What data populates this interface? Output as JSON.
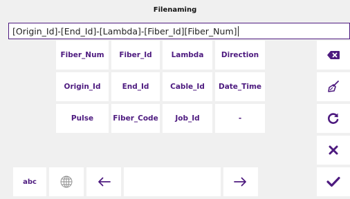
{
  "window": {
    "title": "Filenaming"
  },
  "input": {
    "value": "[Origin_Id]-[End_Id]-[Lambda]-[Fiber_Id][Fiber_Num]"
  },
  "keys": {
    "row1": [
      "Fiber_Num",
      "Fiber_Id",
      "Lambda",
      "Direction"
    ],
    "row2": [
      "Origin_Id",
      "End_Id",
      "Cable_Id",
      "Date_Time"
    ],
    "row3": [
      "Pulse",
      "Fiber_Code",
      "Job_Id",
      "-"
    ]
  },
  "bottom": {
    "abc_label": "abc"
  },
  "icons": {
    "backspace": "backspace-icon",
    "clear": "broom-icon",
    "reset": "refresh-icon",
    "cancel": "close-icon",
    "confirm": "check-icon",
    "language": "globe-icon",
    "left": "arrow-left-icon",
    "right": "arrow-right-icon"
  },
  "colors": {
    "accent": "#4d1a7f",
    "background": "#f0f0f0",
    "key": "#ffffff"
  }
}
